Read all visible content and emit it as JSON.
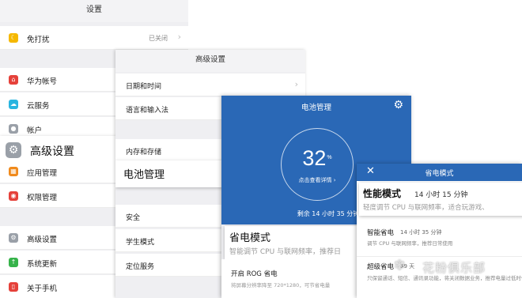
{
  "settings": {
    "title": "设置",
    "dnd": {
      "label": "免打扰",
      "value": "已关闭"
    },
    "items": [
      {
        "label": "华为帐号"
      },
      {
        "label": "云服务"
      },
      {
        "label": "帐户"
      }
    ],
    "advanced_highlight": "高级设置",
    "items2": [
      {
        "label": "应用管理"
      },
      {
        "label": "权限管理"
      }
    ],
    "items3": [
      {
        "label": "高级设置"
      },
      {
        "label": "系统更新"
      },
      {
        "label": "关于手机"
      }
    ],
    "icon_colors": {
      "dnd": "#f5b800",
      "account": "#e5413a",
      "cloud": "#2ab5e0",
      "user": "#9aa0a8",
      "apps": "#f08a1c",
      "perm": "#e5413a",
      "adv": "#9aa0a8",
      "update": "#36b34a",
      "about": "#e5413a"
    }
  },
  "advanced": {
    "title": "高级设置",
    "items": [
      {
        "label": "日期和时间"
      },
      {
        "label": "语言和输入法"
      },
      {
        "label": "内存和存储"
      }
    ],
    "battery_highlight": "电池管理",
    "items2": [
      {
        "label": "安全"
      },
      {
        "label": "学生模式"
      },
      {
        "label": "定位服务"
      }
    ]
  },
  "battery": {
    "title": "电池管理",
    "gear_icon": "gear-icon",
    "percent": "32",
    "percent_unit": "%",
    "detail": "点击查看详情 ›",
    "remaining": "剩余 14 小时 35 分钟",
    "power_mode_title": "省电模式",
    "power_mode_desc": "智能调节 CPU 与联网频率，推荐日",
    "rog_title": "开启 ROG 省电",
    "rog_desc": "将屏幕分辨率降至 720*1280，可节省电量",
    "accent": "#2a68b6"
  },
  "powersave": {
    "title": "省电模式",
    "close_icon": "close-icon",
    "perf_title": "性能模式",
    "perf_hours": "14 小时 15 分钟",
    "perf_desc": "轻度调节 CPU 与联网频率，适合玩游戏、",
    "smart_title": "智能省电",
    "smart_hours": "14 小时 35 分钟",
    "smart_desc": "调节 CPU 与联网频率，推荐日常使用",
    "super_title": "超级省电",
    "super_hours": "39 天",
    "super_desc": "只保留通话、短信、通讯录功能，将关闭数据业务，推荐电量过低时使用"
  },
  "watermark": {
    "text": "花粉俱乐部"
  }
}
